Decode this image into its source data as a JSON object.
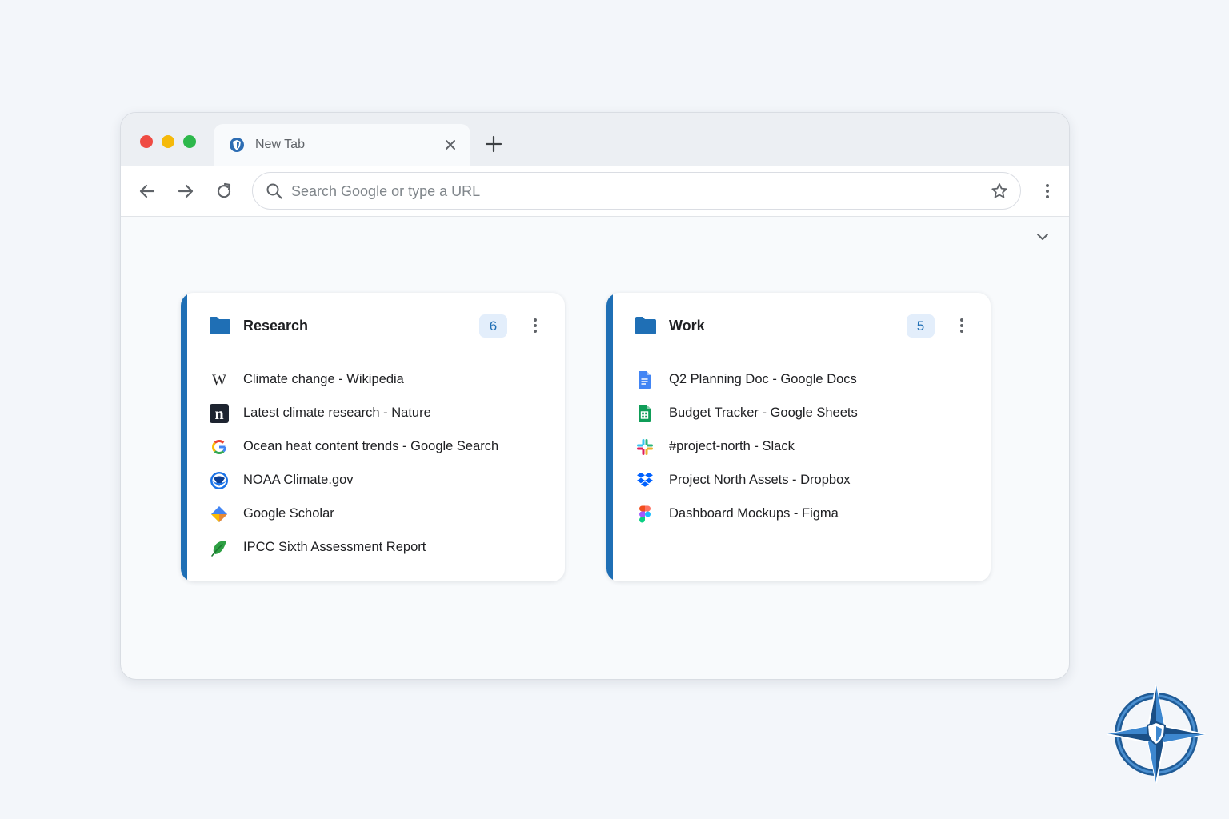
{
  "browser": {
    "tab": {
      "title": "New Tab",
      "favicon": "shield-icon"
    },
    "address_bar": {
      "placeholder": "Search Google or type a URL",
      "value": ""
    },
    "nav": {
      "back": "back-arrow-icon",
      "forward": "forward-arrow-icon",
      "reload": "reload-icon"
    }
  },
  "groups": [
    {
      "name": "Research",
      "count": "6",
      "color": "#1f6fb5",
      "items": [
        {
          "label": "Climate change - Wikipedia",
          "icon": "wikipedia-icon"
        },
        {
          "label": "Latest climate research - Nature",
          "icon": "nature-icon"
        },
        {
          "label": "Ocean heat content trends - Google Search",
          "icon": "google-icon"
        },
        {
          "label": "NOAA Climate.gov",
          "icon": "noaa-icon"
        },
        {
          "label": "Google Scholar",
          "icon": "scholar-icon"
        },
        {
          "label": "IPCC Sixth Assessment Report",
          "icon": "leaf-icon"
        }
      ]
    },
    {
      "name": "Work",
      "count": "5",
      "color": "#1f6fb5",
      "items": [
        {
          "label": "Q2 Planning Doc - Google Docs",
          "icon": "google-docs-icon"
        },
        {
          "label": "Budget Tracker - Google Sheets",
          "icon": "google-sheets-icon"
        },
        {
          "label": "#project-north - Slack",
          "icon": "slack-icon"
        },
        {
          "label": "Project North Assets - Dropbox",
          "icon": "dropbox-icon"
        },
        {
          "label": "Dashboard Mockups - Figma",
          "icon": "figma-icon"
        }
      ]
    }
  ]
}
